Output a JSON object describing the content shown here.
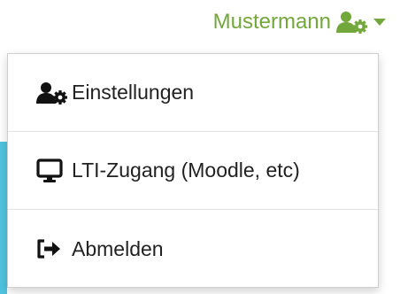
{
  "header": {
    "username": "Mustermann",
    "user_icon": "user-cog-icon",
    "caret_icon": "caret-down-icon"
  },
  "menu": {
    "items": [
      {
        "label": "Einstellungen",
        "icon": "user-cog-icon"
      },
      {
        "label": "LTI-Zugang (Moodle, etc)",
        "icon": "desktop-monitor-icon"
      },
      {
        "label": "Abmelden",
        "icon": "sign-out-icon"
      }
    ]
  },
  "colors": {
    "accent": "#72a83b",
    "side_accent": "#4fc3df",
    "text": "#222222"
  }
}
